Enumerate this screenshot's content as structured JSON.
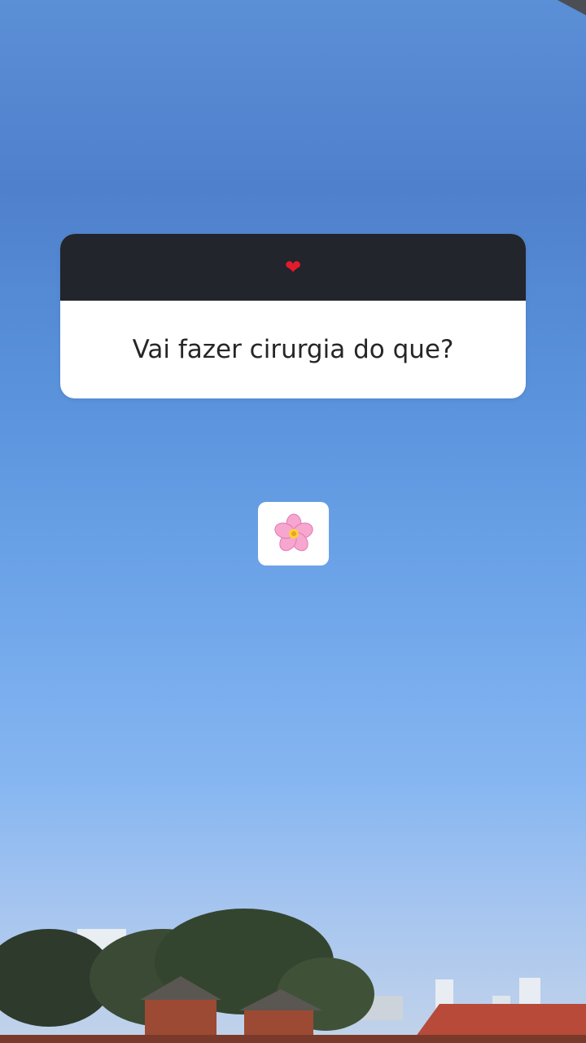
{
  "question": {
    "header_icon": "heart-icon",
    "header_glyph": "❤",
    "text": "Vai fazer cirurgia do que?"
  },
  "reply_sticker": {
    "icon": "cherry-blossom-icon"
  },
  "colors": {
    "sky_top": "#5b8fd6",
    "sky_bottom": "#c2d3ea",
    "question_header": "#22252b",
    "question_body": "#ffffff",
    "heart": "#e41b2c"
  }
}
